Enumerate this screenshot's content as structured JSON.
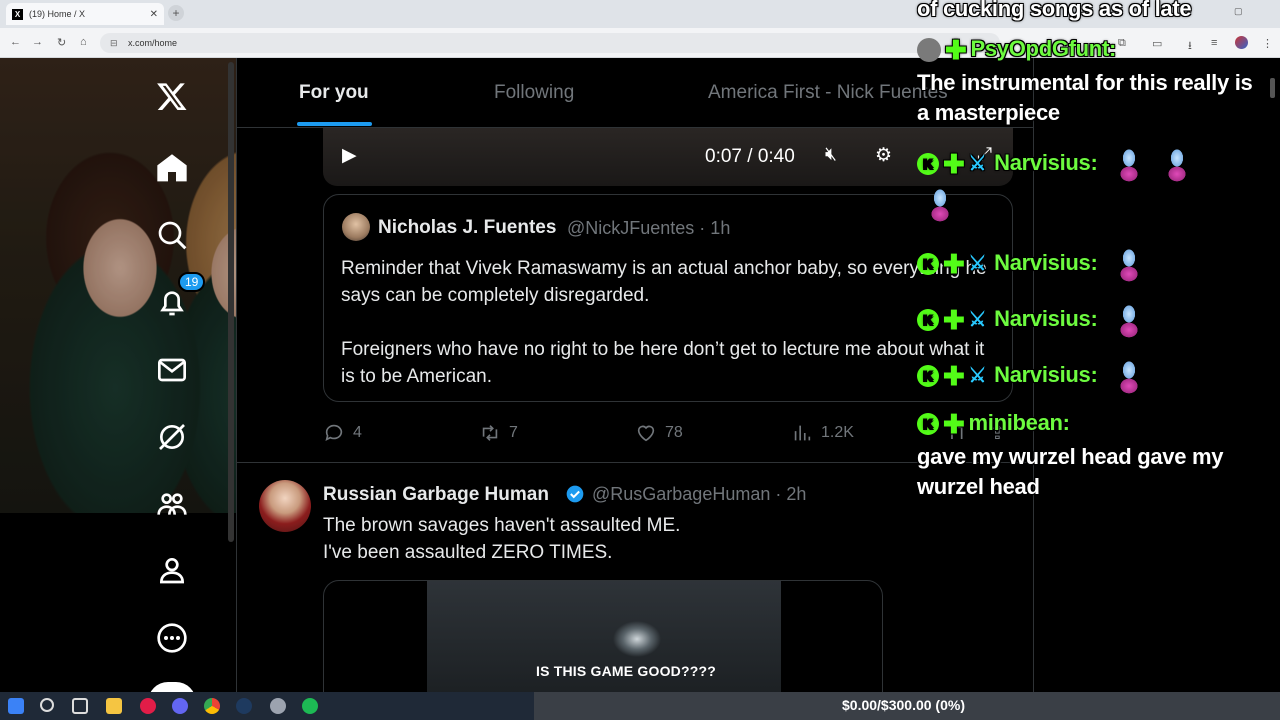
{
  "browser": {
    "tab_title": "(19) Home / X",
    "tab_close": "✕",
    "new_tab": "+",
    "url": "x.com/home"
  },
  "sidebar": {
    "notifications_badge": "19"
  },
  "topnav": {
    "tabs": [
      "For you",
      "Following",
      "America First - Nick Fuentes"
    ]
  },
  "video": {
    "time": "0:07 / 0:40"
  },
  "quoted_post": {
    "name": "Nicholas J. Fuentes",
    "handle": "@NickJFuentes · 1h",
    "text_p1": "Reminder that Vivek Ramaswamy is an actual anchor baby, so everything he says can be completely disregarded.",
    "text_p2": "Foreigners who have no right to be here don’t get to lecture me about what it is to be American."
  },
  "actions": {
    "replies": "4",
    "reposts": "7",
    "likes": "78",
    "views": "1.2K"
  },
  "post2": {
    "name": "Russian Garbage Human",
    "handle": "@RusGarbageHuman · 2h",
    "line1": "The brown savages haven't assaulted ME.",
    "line2": "I've been assaulted ZERO TIMES.",
    "media_caption": "IS THIS GAME GOOD????"
  },
  "chat": {
    "top_fragment": "of cucking songs as of late",
    "msg1_user": "PsyOpdGfunt:",
    "msg1_text_a": "The instrumental for this really is",
    "msg1_text_b": "a masterpiece",
    "narvisius": "Narvisius:",
    "msg6_user": "minibean:",
    "msg6_text_a": "gave my wurzel head gave my",
    "msg6_text_b": "wurzel head"
  },
  "taskbar": {
    "donation_goal": "$0.00/$300.00 (0%)"
  },
  "colors": {
    "accent": "#1d9bf0",
    "chat_username": "#6dfb3f",
    "kick_green": "#53fc18"
  }
}
